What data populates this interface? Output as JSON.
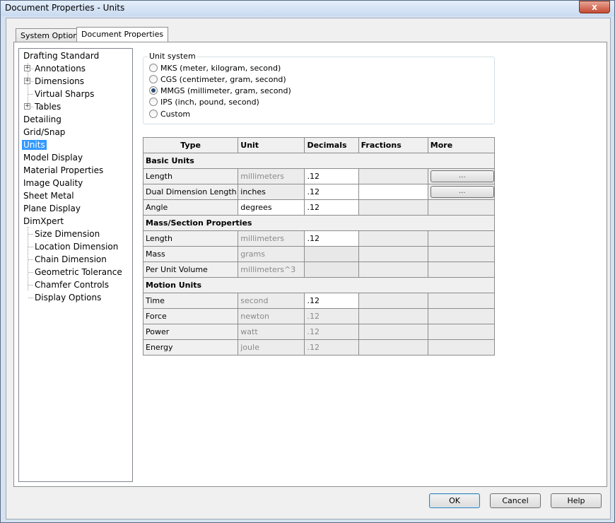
{
  "window": {
    "title": "Document Properties - Units",
    "close_label": "x"
  },
  "tabs": [
    {
      "label": "System Options"
    },
    {
      "label": "Document Properties"
    }
  ],
  "tree": {
    "items": [
      {
        "label": "Drafting Standard"
      },
      {
        "label": "Annotations"
      },
      {
        "label": "Dimensions"
      },
      {
        "label": "Virtual Sharps"
      },
      {
        "label": "Tables"
      },
      {
        "label": "Detailing"
      },
      {
        "label": "Grid/Snap"
      },
      {
        "label": "Units"
      },
      {
        "label": "Model Display"
      },
      {
        "label": "Material Properties"
      },
      {
        "label": "Image Quality"
      },
      {
        "label": "Sheet Metal"
      },
      {
        "label": "Plane Display"
      },
      {
        "label": "DimXpert"
      },
      {
        "label": "Size Dimension"
      },
      {
        "label": "Location Dimension"
      },
      {
        "label": "Chain Dimension"
      },
      {
        "label": "Geometric Tolerance"
      },
      {
        "label": "Chamfer Controls"
      },
      {
        "label": "Display Options"
      }
    ],
    "selected": "Units"
  },
  "unit_system": {
    "legend": "Unit system",
    "options": [
      {
        "label": "MKS  (meter, kilogram, second)"
      },
      {
        "label": "CGS  (centimeter, gram, second)"
      },
      {
        "label": "MMGS (millimeter, gram, second)"
      },
      {
        "label": "IPS  (inch, pound, second)"
      },
      {
        "label": "Custom"
      }
    ],
    "selected": "MMGS (millimeter, gram, second)"
  },
  "units_table": {
    "columns": [
      "Type",
      "Unit",
      "Decimals",
      "Fractions",
      "More"
    ],
    "sections": [
      {
        "title": "Basic Units",
        "rows": [
          {
            "type": "Length",
            "unit": "millimeters",
            "decimals": ".12",
            "more": "..."
          },
          {
            "type": "Dual Dimension Length",
            "unit": "inches",
            "decimals": ".12",
            "more": "..."
          },
          {
            "type": "Angle",
            "unit": "degrees",
            "decimals": ".12"
          }
        ]
      },
      {
        "title": "Mass/Section Properties",
        "rows": [
          {
            "type": "Length",
            "unit": "millimeters",
            "decimals": ".12"
          },
          {
            "type": "Mass",
            "unit": "grams"
          },
          {
            "type": "Per Unit Volume",
            "unit": "millimeters^3"
          }
        ]
      },
      {
        "title": "Motion Units",
        "rows": [
          {
            "type": "Time",
            "unit": "second",
            "decimals": ".12"
          },
          {
            "type": "Force",
            "unit": "newton",
            "decimals": ".12"
          },
          {
            "type": "Power",
            "unit": "watt",
            "decimals": ".12"
          },
          {
            "type": "Energy",
            "unit": "joule",
            "decimals": ".12"
          }
        ]
      }
    ]
  },
  "buttons": {
    "ok": "OK",
    "cancel": "Cancel",
    "help": "Help"
  }
}
